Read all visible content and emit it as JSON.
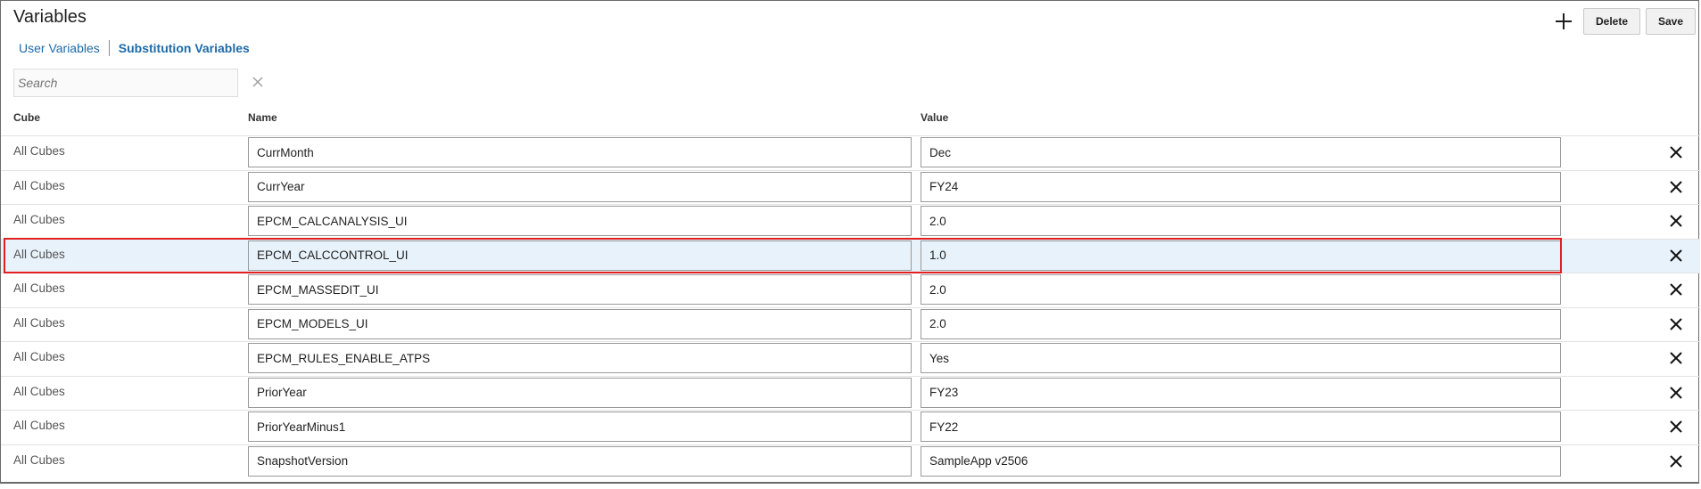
{
  "header": {
    "title": "Variables",
    "delete_label": "Delete",
    "save_label": "Save"
  },
  "tabs": [
    {
      "label": "User Variables"
    },
    {
      "label": "Substitution Variables"
    }
  ],
  "search": {
    "placeholder": "Search",
    "value": ""
  },
  "table": {
    "columns": [
      "Cube",
      "Name",
      "Value"
    ],
    "rows": [
      {
        "cube": "All Cubes",
        "name": "CurrMonth",
        "value": "Dec"
      },
      {
        "cube": "All Cubes",
        "name": "CurrYear",
        "value": "FY24"
      },
      {
        "cube": "All Cubes",
        "name": "EPCM_CALCANALYSIS_UI",
        "value": "2.0"
      },
      {
        "cube": "All Cubes",
        "name": "EPCM_CALCCONTROL_UI",
        "value": "1.0"
      },
      {
        "cube": "All Cubes",
        "name": "EPCM_MASSEDIT_UI",
        "value": "2.0"
      },
      {
        "cube": "All Cubes",
        "name": "EPCM_MODELS_UI",
        "value": "2.0"
      },
      {
        "cube": "All Cubes",
        "name": "EPCM_RULES_ENABLE_ATPS",
        "value": "Yes"
      },
      {
        "cube": "All Cubes",
        "name": "PriorYear",
        "value": "FY23"
      },
      {
        "cube": "All Cubes",
        "name": "PriorYearMinus1",
        "value": "FY22"
      },
      {
        "cube": "All Cubes",
        "name": "SnapshotVersion",
        "value": "SampleApp v2506"
      }
    ]
  },
  "colors": {
    "link": "#1d6aa8",
    "selected_row": "#e8f2fa",
    "highlight_border": "#e02020"
  },
  "icons": {
    "add": "plus-icon",
    "clear_search": "close-icon",
    "row_delete": "close-icon"
  }
}
